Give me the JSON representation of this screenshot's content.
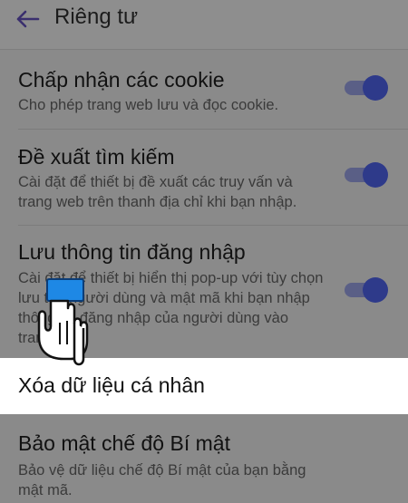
{
  "header": {
    "title": "Riêng tư"
  },
  "settings": {
    "items": [
      {
        "title": "Chấp nhận các cookie",
        "description": "Cho phép trang web lưu và đọc cookie.",
        "toggle_on": true
      },
      {
        "title": "Đề xuất tìm kiếm",
        "description": "Cài đặt để thiết bị đề xuất các truy vấn và trang web trên thanh địa chỉ khi bạn nhập.",
        "toggle_on": true
      },
      {
        "title": "Lưu thông tin đăng nhập",
        "description": "Cài đặt để thiết bị hiển thị pop-up với tùy chọn lưu tên người dùng và mật mã khi bạn nhập thông tin đăng nhập của người dùng vào trang web.",
        "toggle_on": true
      },
      {
        "title": "Xóa dữ liệu cá nhân"
      },
      {
        "title": "Bảo mật chế độ Bí mật",
        "description": "Bảo vệ dữ liệu chế độ Bí mật của bạn bằng mật mã."
      }
    ]
  },
  "colors": {
    "toggle_knob": "#2e3a8a",
    "toggle_track": "#5a5f86",
    "highlight": "#ffffff",
    "pointer_cuff": "#1e88e5"
  }
}
